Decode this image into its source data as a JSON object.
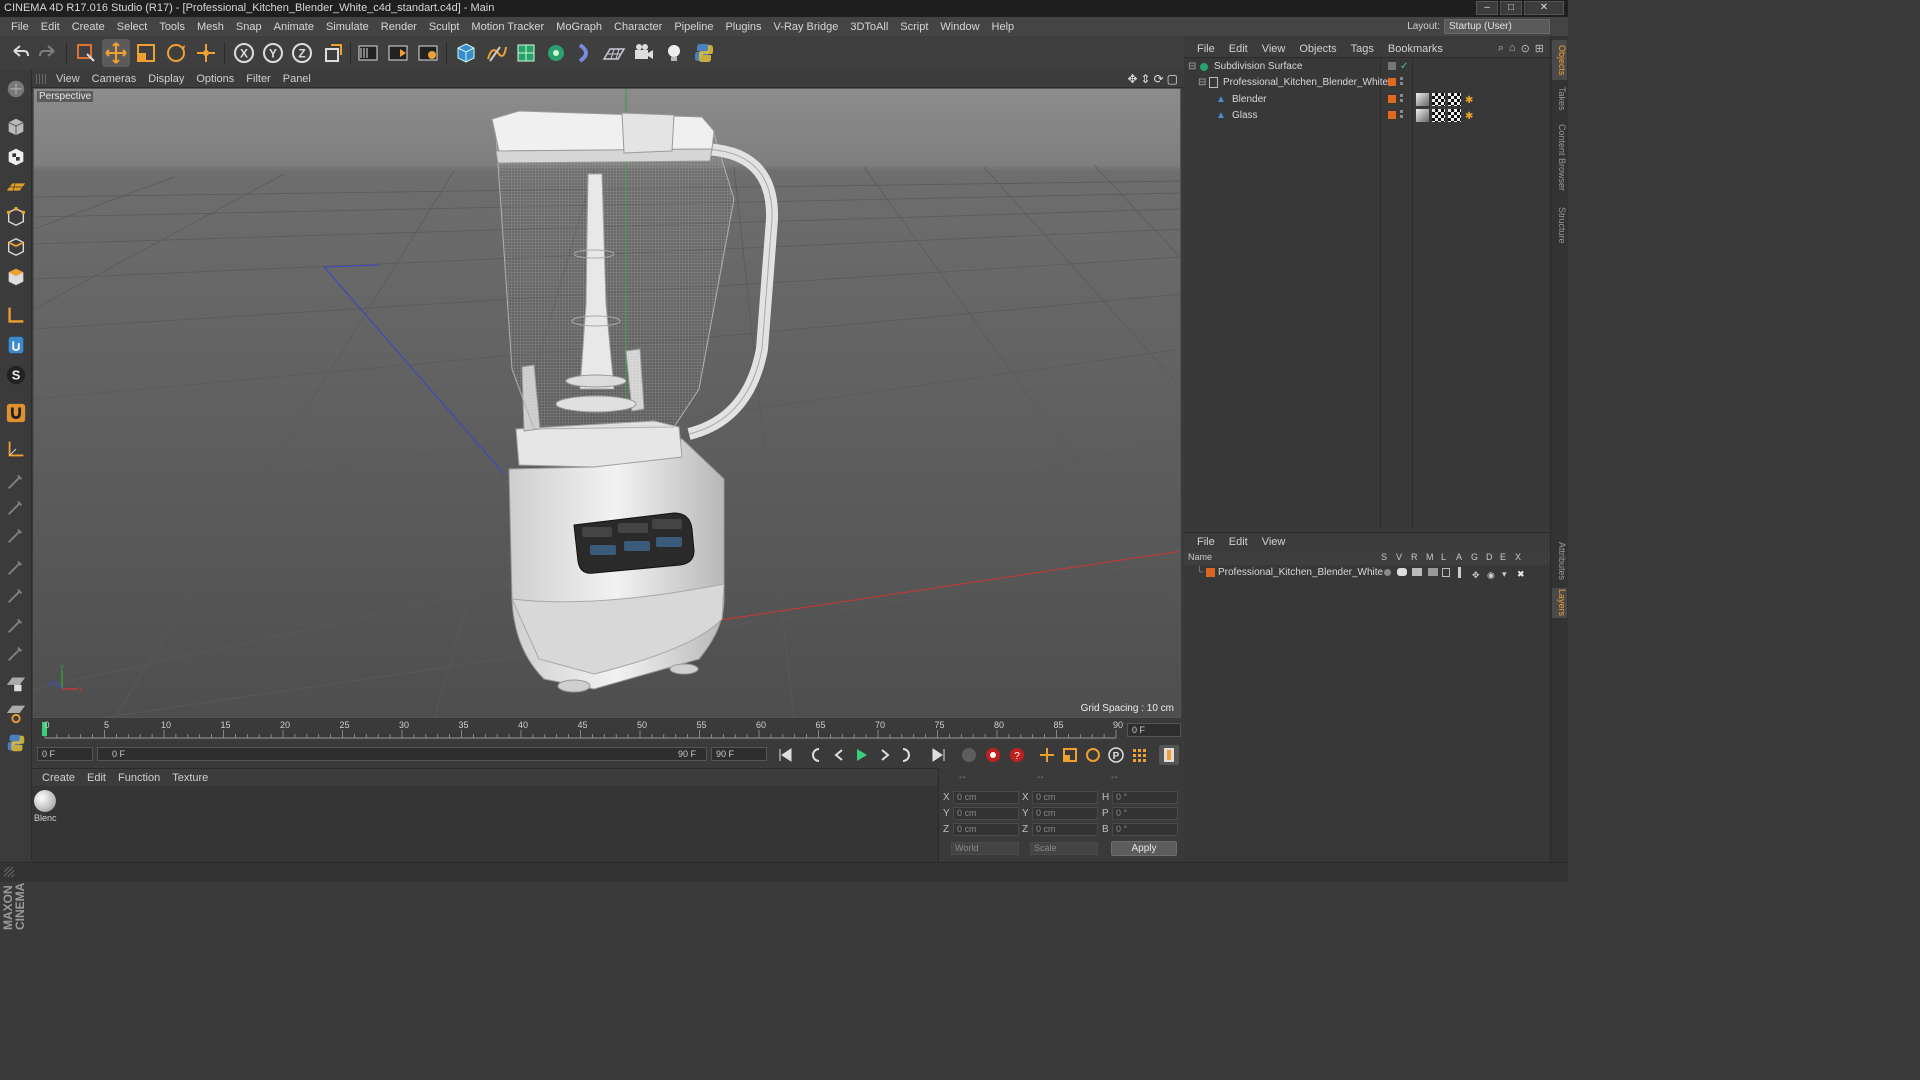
{
  "window": {
    "title": "CINEMA 4D R17.016 Studio (R17) - [Professional_Kitchen_Blender_White_c4d_standart.c4d] - Main"
  },
  "menubar": {
    "items": [
      "File",
      "Edit",
      "Create",
      "Select",
      "Tools",
      "Mesh",
      "Snap",
      "Animate",
      "Simulate",
      "Render",
      "Sculpt",
      "Motion Tracker",
      "MoGraph",
      "Character",
      "Pipeline",
      "Plugins",
      "V-Ray Bridge",
      "3DToAll",
      "Script",
      "Window",
      "Help"
    ],
    "layout_label": "Layout:",
    "layout_value": "Startup (User)"
  },
  "viewport": {
    "menu": [
      "View",
      "Cameras",
      "Display",
      "Options",
      "Filter",
      "Panel"
    ],
    "label": "Perspective",
    "grid_spacing": "Grid Spacing : 10 cm"
  },
  "timeline": {
    "ticks": [
      "0",
      "5",
      "10",
      "15",
      "20",
      "25",
      "30",
      "35",
      "40",
      "45",
      "50",
      "55",
      "60",
      "65",
      "70",
      "75",
      "80",
      "85",
      "90"
    ],
    "end_frame_display": "0 F",
    "current_frame": "0 F",
    "range_start": "0 F",
    "range_end": "90 F",
    "max_frame": "90 F"
  },
  "material_panel": {
    "menu": [
      "Create",
      "Edit",
      "Function",
      "Texture"
    ],
    "materials": [
      {
        "name": "Blenc"
      }
    ]
  },
  "coordinates": {
    "headers": [
      "--",
      "--",
      "--"
    ],
    "rows": [
      {
        "axis": "X",
        "pos": "0 cm",
        "size_axis": "X",
        "size": "0 cm",
        "rot_axis": "H",
        "rot": "0 °"
      },
      {
        "axis": "Y",
        "pos": "0 cm",
        "size_axis": "Y",
        "size": "0 cm",
        "rot_axis": "P",
        "rot": "0 °"
      },
      {
        "axis": "Z",
        "pos": "0 cm",
        "size_axis": "Z",
        "size": "0 cm",
        "rot_axis": "B",
        "rot": "0 °"
      }
    ],
    "space": "World",
    "mode": "Scale",
    "apply": "Apply"
  },
  "object_manager": {
    "menu": [
      "File",
      "Edit",
      "View",
      "Objects",
      "Tags",
      "Bookmarks"
    ],
    "objects": [
      {
        "name": "Subdivision Surface"
      },
      {
        "name": "Professional_Kitchen_Blender_White"
      },
      {
        "name": "Blender"
      },
      {
        "name": "Glass"
      }
    ]
  },
  "layer_manager": {
    "menu": [
      "File",
      "Edit",
      "View"
    ],
    "columns": [
      "Name",
      "S",
      "V",
      "R",
      "M",
      "L",
      "A",
      "G",
      "D",
      "E",
      "X"
    ],
    "layers": [
      {
        "name": "Professional_Kitchen_Blender_White"
      }
    ]
  },
  "right_tabs": [
    "Objects",
    "Takes",
    "Content Browser",
    "Structure",
    "Attributes",
    "Layers"
  ],
  "branding": "MAXON CINEMA 4D",
  "colors": {
    "accent_orange": "#e08a2a",
    "axis_x": "#c03a3a",
    "axis_y": "#3a9a3a",
    "axis_z": "#3a4ac0",
    "layer_color": "#d9651e"
  }
}
